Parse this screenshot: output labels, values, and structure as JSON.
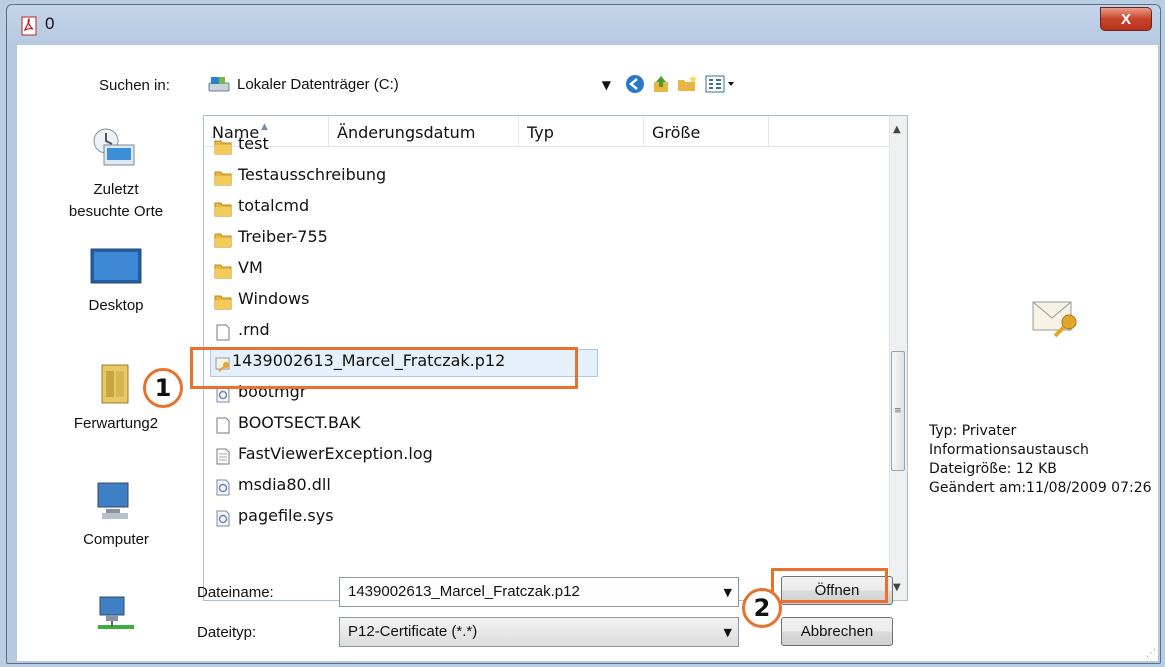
{
  "window": {
    "title": "0",
    "close_label": "X"
  },
  "lookin": {
    "label": "Suchen in:",
    "value": "Lokaler Datenträger (C:)"
  },
  "places": [
    {
      "id": "recent",
      "label_line1": "Zuletzt",
      "label_line2": "besuchte Orte"
    },
    {
      "id": "desktop",
      "label_line1": "Desktop",
      "label_line2": ""
    },
    {
      "id": "user",
      "label_line1": "Ferwartung2",
      "label_line2": ""
    },
    {
      "id": "computer",
      "label_line1": "Computer",
      "label_line2": ""
    },
    {
      "id": "network",
      "label_line1": "",
      "label_line2": ""
    }
  ],
  "columns": [
    "Name",
    "Änderungsdatum",
    "Typ",
    "Größe"
  ],
  "files": [
    {
      "name": "test",
      "kind": "folder"
    },
    {
      "name": "Testausschreibung",
      "kind": "folder"
    },
    {
      "name": "totalcmd",
      "kind": "folder"
    },
    {
      "name": "Treiber-755",
      "kind": "folder"
    },
    {
      "name": "VM",
      "kind": "folder"
    },
    {
      "name": "Windows",
      "kind": "folder"
    },
    {
      "name": ".rnd",
      "kind": "file"
    },
    {
      "name": "1439002613_Marcel_Fratczak.p12",
      "kind": "cert",
      "selected": true
    },
    {
      "name": "bootmgr",
      "kind": "sys"
    },
    {
      "name": "BOOTSECT.BAK",
      "kind": "file"
    },
    {
      "name": "FastViewerException.log",
      "kind": "text"
    },
    {
      "name": "msdia80.dll",
      "kind": "sys"
    },
    {
      "name": "pagefile.sys",
      "kind": "sys"
    }
  ],
  "details": {
    "line1": "Typ: Privater",
    "line2": "Informationsaustausch",
    "line3": "Dateigröße: 12 KB",
    "line4": "Geändert am:11/08/2009 07:26"
  },
  "filename": {
    "label": "Dateiname:",
    "value": "1439002613_Marcel_Fratczak.p12"
  },
  "filetype": {
    "label": "Dateityp:",
    "value": "P12-Certificate (*.*)"
  },
  "buttons": {
    "open": "Öffnen",
    "cancel": "Abbrechen"
  },
  "callouts": {
    "one": "1",
    "two": "2"
  },
  "colors": {
    "highlight": "#e8712e",
    "folder": "#e9b741",
    "selection": "#e6f0fb"
  }
}
